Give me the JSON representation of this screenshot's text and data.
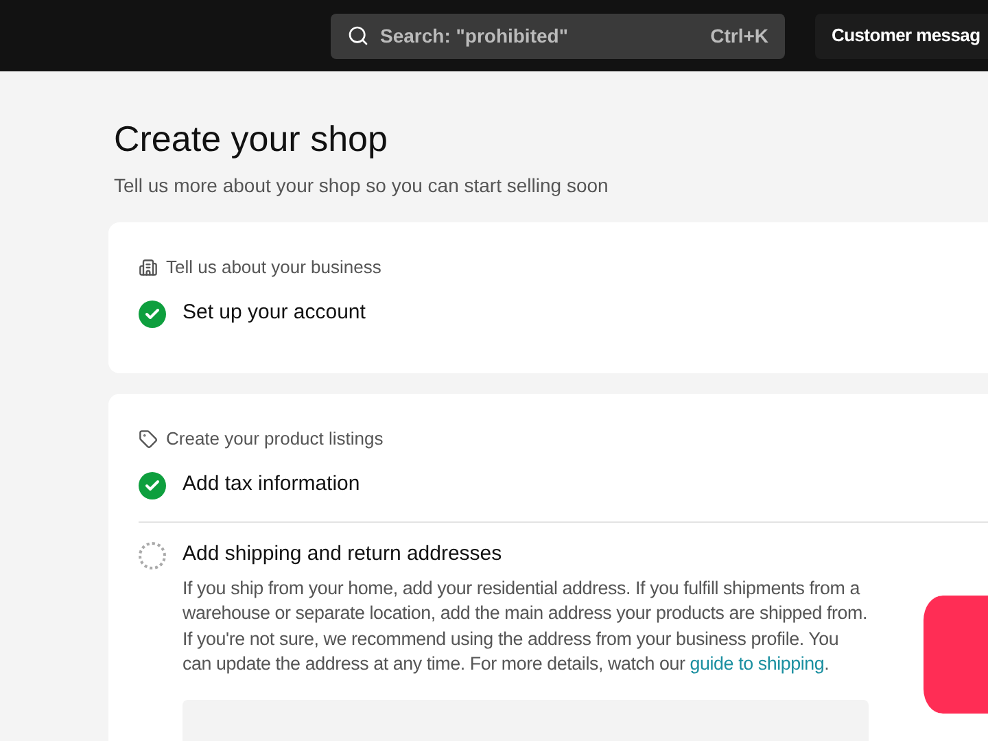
{
  "top_bar": {
    "search": {
      "placeholder": "Search: \"prohibited\"",
      "shortcut": "Ctrl+K"
    },
    "button": "Customer messag"
  },
  "page": {
    "title": "Create your shop",
    "subtitle": "Tell us more about your shop so you can start selling soon"
  },
  "sections": [
    {
      "heading": "Tell us about your business",
      "kind": "building",
      "steps": [
        {
          "title": "Set up your account",
          "completed": true
        }
      ]
    },
    {
      "heading": "Create your product listings",
      "kind": "tag",
      "steps": [
        {
          "title": "Add tax information",
          "completed": true
        },
        {
          "title": "Add shipping and return addresses",
          "completed": false,
          "description": "If you ship from your home, add your residential address. If you fulfill shipments from a warehouse or separate location, add the main address your products are shipped from. If you're not sure, we recommend using the address from your business profile. You can update the address at any time. For more details, watch our ",
          "link": "guide to shipping",
          "after_link": "."
        }
      ]
    }
  ]
}
